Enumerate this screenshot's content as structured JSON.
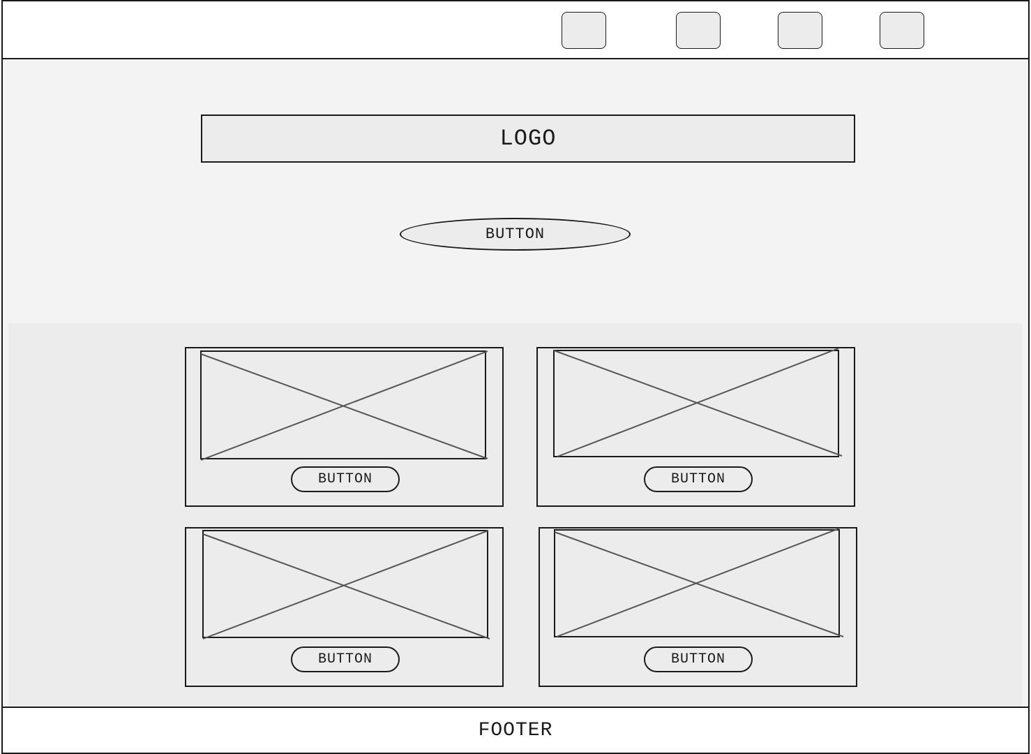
{
  "header": {
    "nav_buttons": [
      {
        "label": ""
      },
      {
        "label": ""
      },
      {
        "label": ""
      },
      {
        "label": ""
      }
    ]
  },
  "hero": {
    "logo_text": "LOGO",
    "button_label": "BUTTON"
  },
  "cards": [
    {
      "button_label": "BUTTON"
    },
    {
      "button_label": "BUTTON"
    },
    {
      "button_label": "BUTTON"
    },
    {
      "button_label": "BUTTON"
    }
  ],
  "footer": {
    "text": "FOOTER"
  },
  "colors": {
    "stroke": "#1a1a1a",
    "placeholder_cross": "#555555",
    "fill": "#ececec",
    "background": "#f3f3f3"
  }
}
